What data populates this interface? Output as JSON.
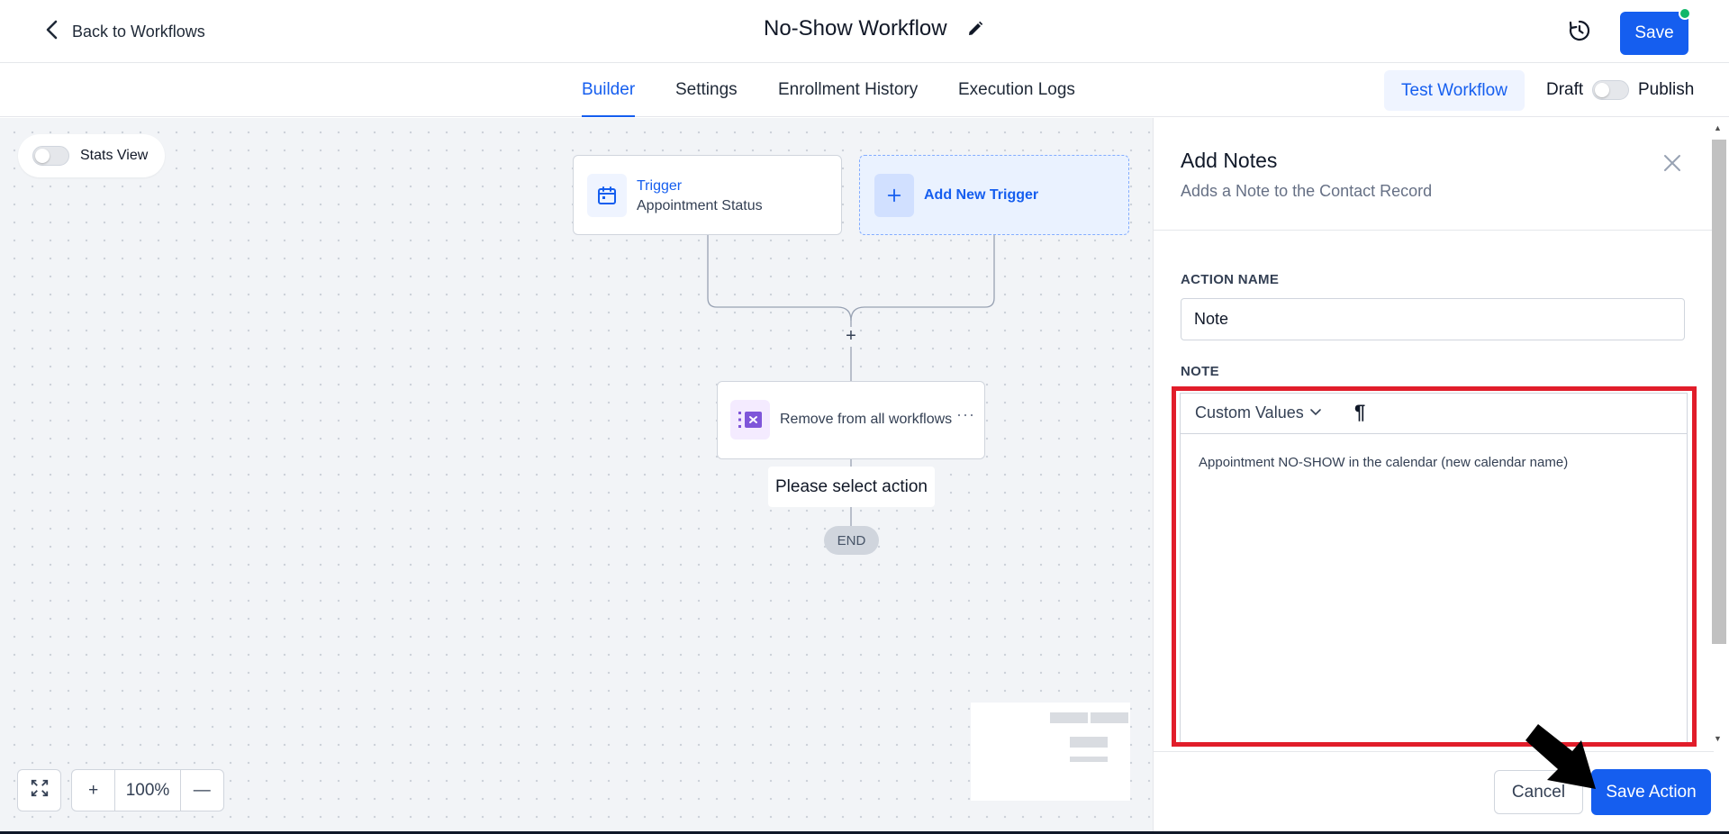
{
  "header": {
    "back_label": "Back to Workflows",
    "title": "No-Show Workflow",
    "save_label": "Save",
    "status_dot_color": "#12b76a"
  },
  "tabs": [
    {
      "label": "Builder",
      "active": true
    },
    {
      "label": "Settings",
      "active": false
    },
    {
      "label": "Enrollment History",
      "active": false
    },
    {
      "label": "Execution Logs",
      "active": false
    }
  ],
  "tabbar_actions": {
    "test_label": "Test Workflow",
    "draft_label": "Draft",
    "publish_label": "Publish",
    "published": false
  },
  "canvas": {
    "stats_label": "Stats View",
    "stats_on": false,
    "trigger": {
      "title": "Trigger",
      "subtitle": "Appointment Status"
    },
    "add_trigger_label": "Add New Trigger",
    "add_step_symbol": "+",
    "action": {
      "label": "Remove from all workflows",
      "menu_symbol": "···"
    },
    "select_tip": "Please select action",
    "end_label": "END",
    "zoom": {
      "in_symbol": "+",
      "value": "100%",
      "out_symbol": "—"
    }
  },
  "panel": {
    "title": "Add Notes",
    "subtitle": "Adds a Note to the Contact Record",
    "action_name_label": "ACTION NAME",
    "action_name_value": "Note",
    "note_label": "NOTE",
    "custom_values_label": "Custom Values",
    "pilcrow": "¶",
    "note_text": "Appointment NO-SHOW in the calendar (new calendar name)",
    "cancel_label": "Cancel",
    "save_action_label": "Save Action"
  },
  "colors": {
    "accent": "#155eef",
    "highlight": "#e11d2a"
  }
}
